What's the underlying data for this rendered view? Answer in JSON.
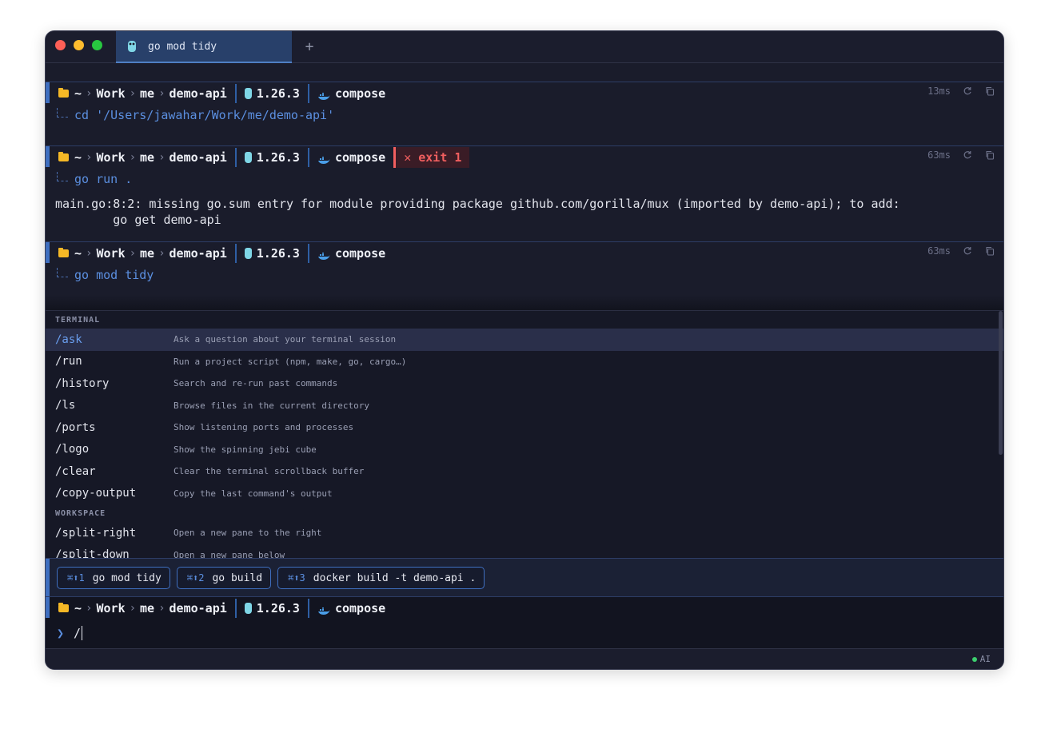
{
  "tab": {
    "title": "go mod tidy",
    "new_tab": "+"
  },
  "prompt": {
    "home": "~",
    "path": [
      "Work",
      "me",
      "demo-api"
    ],
    "go_version": "1.26.3",
    "docker": "compose"
  },
  "blocks": [
    {
      "duration": "13ms",
      "command": "cd '/Users/jawahar/Work/me/demo-api'",
      "exit": "",
      "output": ""
    },
    {
      "duration": "63ms",
      "command": "go run .",
      "exit": "✕ exit 1",
      "output": "main.go:8:2: missing go.sum entry for module providing package github.com/gorilla/mux (imported by demo-api); to add:\n        go get demo-api"
    },
    {
      "duration": "63ms",
      "command": "go mod tidy",
      "exit": "",
      "output": ""
    }
  ],
  "palette": {
    "sections": [
      {
        "title": "TERMINAL",
        "items": [
          {
            "name": "/ask",
            "desc": "Ask a question about your terminal session"
          },
          {
            "name": "/run",
            "desc": "Run a project script (npm, make, go, cargo…)"
          },
          {
            "name": "/history",
            "desc": "Search and re-run past commands"
          },
          {
            "name": "/ls",
            "desc": "Browse files in the current directory"
          },
          {
            "name": "/ports",
            "desc": "Show listening ports and processes"
          },
          {
            "name": "/logo",
            "desc": "Show the spinning jebi cube"
          },
          {
            "name": "/clear",
            "desc": "Clear the terminal scrollback buffer"
          },
          {
            "name": "/copy-output",
            "desc": "Copy the last command's output"
          }
        ]
      },
      {
        "title": "WORKSPACE",
        "items": [
          {
            "name": "/split-right",
            "desc": "Open a new pane to the right"
          },
          {
            "name": "/split-down",
            "desc": "Open a new pane below"
          }
        ]
      }
    ]
  },
  "suggestions": [
    {
      "key": "⌘⬆1",
      "label": "go mod tidy"
    },
    {
      "key": "⌘⬆2",
      "label": "go build"
    },
    {
      "key": "⌘⬆3",
      "label": "docker build -t demo-api ."
    }
  ],
  "input": {
    "prompt_char": "❯",
    "value": "/"
  },
  "status": {
    "ai": "AI"
  },
  "colors": {
    "accent": "#3f6fc0",
    "error": "#f25f5f",
    "folder": "#f5b826",
    "ai_dot": "#3ccf6e"
  }
}
